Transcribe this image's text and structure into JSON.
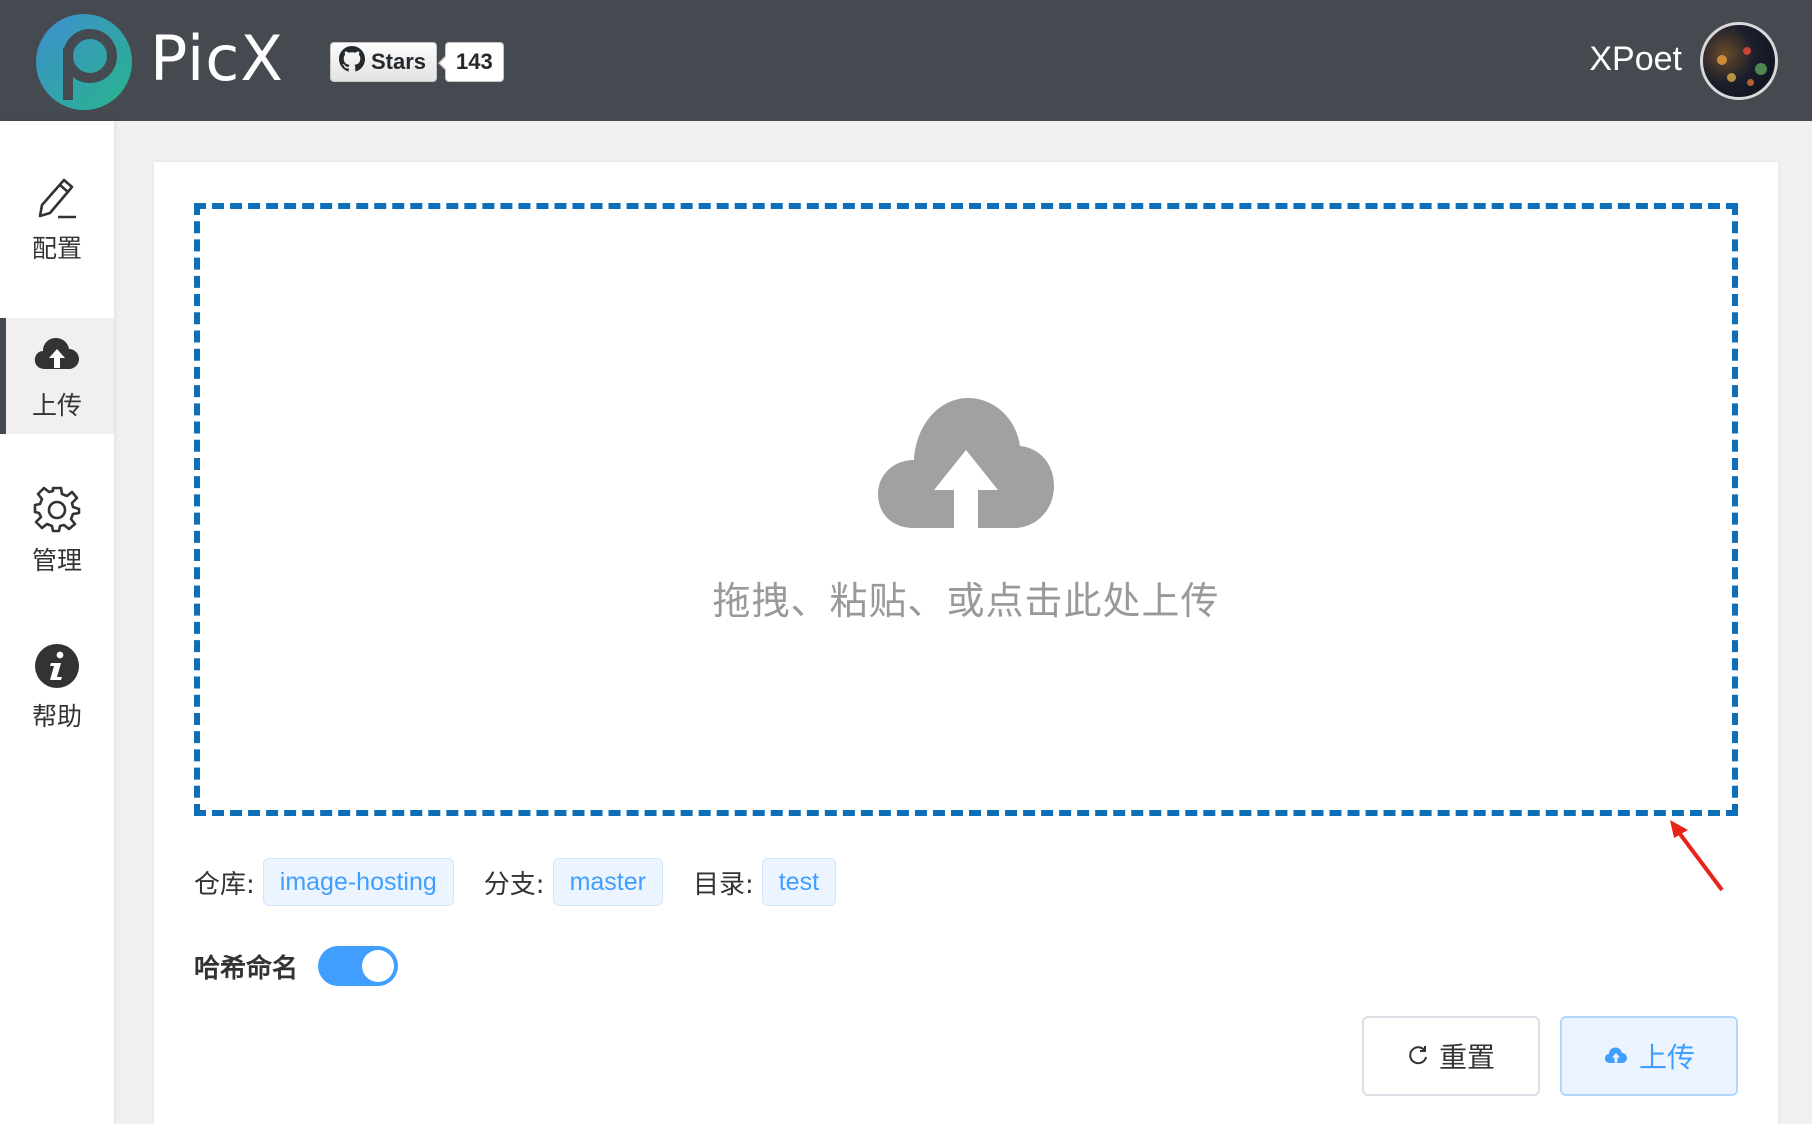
{
  "header": {
    "brand": "PicX",
    "github": {
      "stars_label": "Stars",
      "stars_count": "143"
    },
    "username": "XPoet"
  },
  "sidebar": {
    "items": [
      {
        "label": "配置",
        "icon": "pencil-icon",
        "active": false
      },
      {
        "label": "上传",
        "icon": "cloud-upload-icon",
        "active": true
      },
      {
        "label": "管理",
        "icon": "gear-icon",
        "active": false
      },
      {
        "label": "帮助",
        "icon": "info-icon",
        "active": false
      }
    ]
  },
  "upload": {
    "drop_text": "拖拽、粘贴、或点击此处上传",
    "repo_label": "仓库:",
    "repo_value": "image-hosting",
    "branch_label": "分支:",
    "branch_value": "master",
    "dir_label": "目录:",
    "dir_value": "test",
    "hash_label": "哈希命名",
    "hash_enabled": true,
    "reset_label": "重置",
    "upload_label": "上传"
  },
  "colors": {
    "header_bg": "#454a51",
    "dropzone_border": "#0e6eb8",
    "accent": "#409eff",
    "annotation_arrow": "#e8231a"
  }
}
